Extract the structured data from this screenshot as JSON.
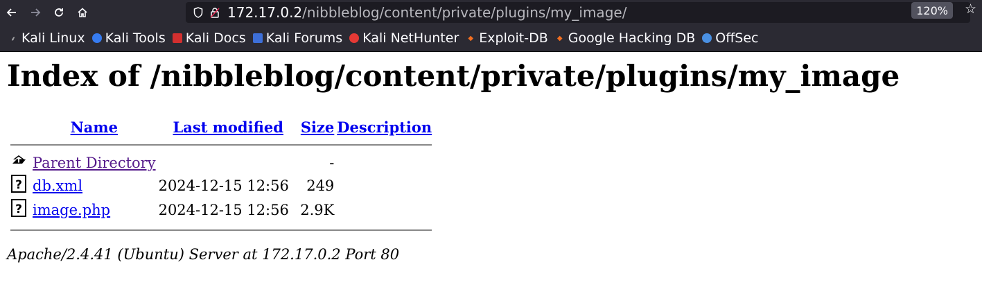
{
  "browser": {
    "url_host": "172.17.0.2",
    "url_path": "/nibbleblog/content/private/plugins/my_image/",
    "zoom": "120%"
  },
  "bookmarks": [
    {
      "label": "Kali Linux",
      "color": "#c9c9c9"
    },
    {
      "label": "Kali Tools",
      "color": "#367bf0"
    },
    {
      "label": "Kali Docs",
      "color": "#d32f2f"
    },
    {
      "label": "Kali Forums",
      "color": "#3d6fd8"
    },
    {
      "label": "Kali NetHunter",
      "color": "#e53935"
    },
    {
      "label": "Exploit-DB",
      "color": "#f36f21"
    },
    {
      "label": "Google Hacking DB",
      "color": "#f36f21"
    },
    {
      "label": "OffSec",
      "color": "#4a90e2"
    }
  ],
  "page": {
    "title": "Index of /nibbleblog/content/private/plugins/my_image",
    "headers": {
      "name": "Name",
      "modified": "Last modified",
      "size": "Size",
      "description": "Description"
    },
    "parent": {
      "name": "Parent Directory",
      "size": "-"
    },
    "rows": [
      {
        "name": "db.xml",
        "modified": "2024-12-15 12:56",
        "size": "249"
      },
      {
        "name": "image.php",
        "modified": "2024-12-15 12:56",
        "size": "2.9K"
      }
    ],
    "footer": "Apache/2.4.41 (Ubuntu) Server at 172.17.0.2 Port 80"
  }
}
